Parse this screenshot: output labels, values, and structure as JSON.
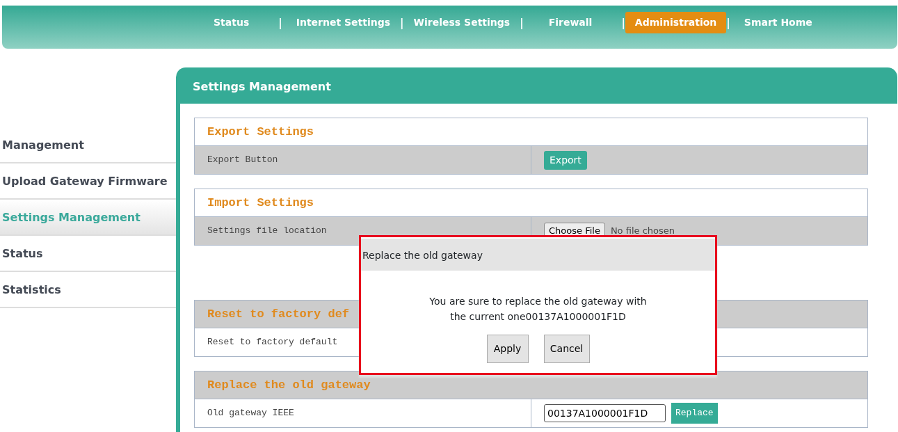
{
  "nav": [
    {
      "label": "Status",
      "selected": false
    },
    {
      "label": "Internet Settings",
      "selected": false
    },
    {
      "label": "Wireless Settings",
      "selected": false
    },
    {
      "label": "Firewall",
      "selected": false
    },
    {
      "label": "Administration",
      "selected": true
    },
    {
      "label": "Smart Home",
      "selected": false
    }
  ],
  "nav_separator": "|",
  "sidebar": {
    "items": [
      {
        "label": "Management",
        "selected": false
      },
      {
        "label": "Upload Gateway Firmware",
        "selected": false
      },
      {
        "label": "Settings Management",
        "selected": true
      },
      {
        "label": "Status",
        "selected": false
      },
      {
        "label": "Statistics",
        "selected": false
      }
    ]
  },
  "panel": {
    "title": "Settings Management",
    "sections": [
      {
        "title": "Export Settings",
        "header_shaded": false,
        "row": {
          "label": "Export Button",
          "kind": "button",
          "button": "Export"
        }
      },
      {
        "title": "Import Settings",
        "header_shaded": false,
        "row": {
          "label": "Settings file location",
          "kind": "file",
          "button": "Choose File",
          "note": "No file chosen"
        }
      },
      {
        "title": "Reset to factory def",
        "header_shaded": true,
        "row": {
          "label": "Reset to factory default",
          "kind": "plain"
        }
      },
      {
        "title": "Replace the old gateway",
        "header_shaded": true,
        "row": {
          "label": "Old gateway IEEE",
          "kind": "input",
          "value": "00137A1000001F1D",
          "button": "Replace"
        }
      }
    ]
  },
  "dialog": {
    "title": "Replace the old gateway",
    "message_lines": [
      "You are sure to replace the old gateway with",
      "the current one00137A1000001F1D"
    ],
    "buttons": [
      "Apply",
      "Cancel"
    ]
  }
}
